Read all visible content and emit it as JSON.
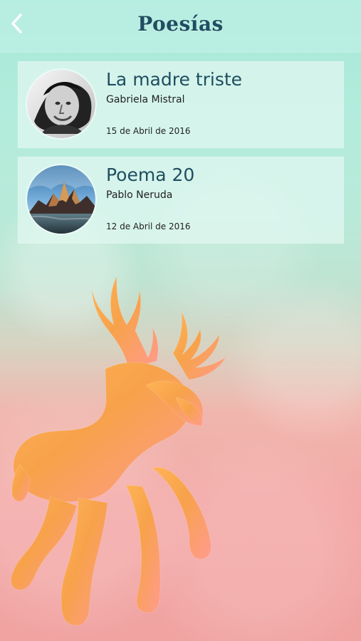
{
  "header": {
    "title": "Poesías",
    "back_icon": "chevron-left-icon"
  },
  "poems": [
    {
      "title": "La madre triste",
      "author": "Gabriela Mistral",
      "date": "15 de Abril de 2016",
      "avatar_icon": "portrait-avatar"
    },
    {
      "title": "Poema 20",
      "author": "Pablo Neruda",
      "date": "12 de Abril de 2016",
      "avatar_icon": "mountain-landscape-avatar"
    }
  ],
  "background": {
    "decoration": "deer-silhouette",
    "accent": "#1f4e60",
    "card_fill": "#e0f7f0",
    "deer_fill": "#f4a24c"
  }
}
